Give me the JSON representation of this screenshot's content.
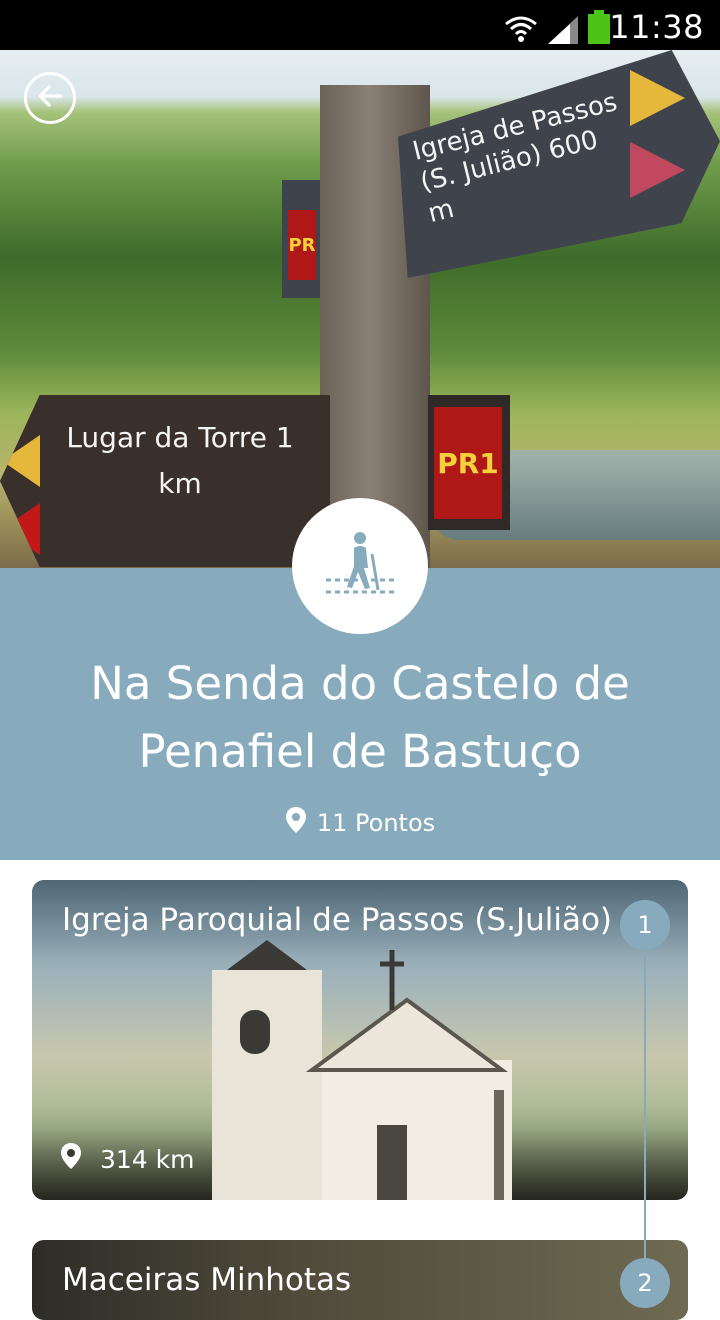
{
  "status_bar": {
    "time": "11:38",
    "icons": [
      "wifi-icon",
      "signal-icon",
      "battery-icon"
    ]
  },
  "hero": {
    "sign_top_text": "Igreja de Passos (S. Julião) 600 m",
    "sign_left_text": "Lugar da Torre 1 km",
    "sign_pr": "PR1",
    "sign_small_pr": "PR"
  },
  "route": {
    "title": "Na Senda do Castelo de Penafiel de Bastuço",
    "points": "11 Pontos",
    "category_icon": "hiking-icon"
  },
  "points_list": [
    {
      "index": "1",
      "name": "Igreja Paroquial de Passos (S.Julião)",
      "distance": "314 km"
    },
    {
      "index": "2",
      "name": "Maceiras Minhotas"
    }
  ],
  "colors": {
    "accent": "#87abbd",
    "status_bar": "#000000",
    "background": "#ffffff"
  }
}
